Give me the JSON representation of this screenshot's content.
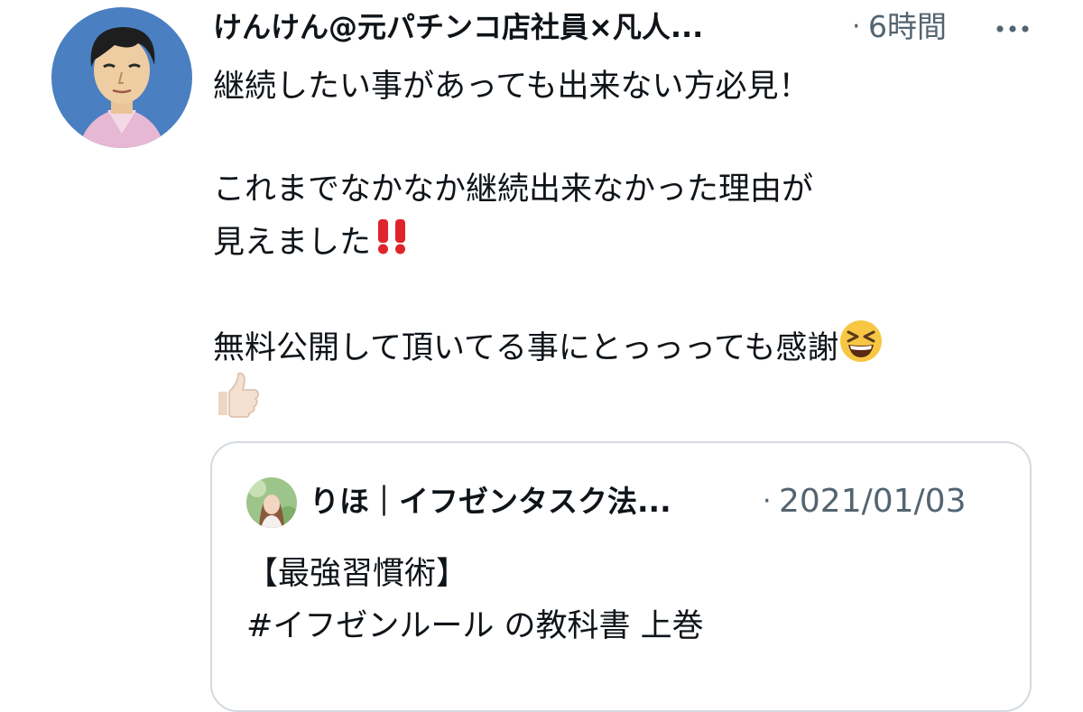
{
  "tweet": {
    "author": {
      "display_name": "けんけん@元パチンコ店社員×凡人...",
      "avatar_icon": "cartoon-man-avatar"
    },
    "separator": "·",
    "time": "6時間",
    "more_icon": "more-horizontal-icon",
    "body": {
      "line1": "継続したい事があっても出来ない方必見！",
      "line2": "これまでなかなか継続出来なかった理由が",
      "line3": "見えました",
      "line3_emoji": "double-exclamation-emoji",
      "line4": "無料公開して頂いてる事にとっっっても感謝",
      "line4_emoji": "grinning-squinting-face-emoji",
      "line5_emoji": "thumbs-up-emoji"
    },
    "quote": {
      "author": {
        "display_name": "りほ｜イフゼンタスク法...",
        "avatar_icon": "woman-photo-avatar"
      },
      "separator": "·",
      "date": "2021/01/03",
      "text_line1": "【最強習慣術】",
      "text_line2": "#イフゼンルール の教科書 上巻"
    }
  },
  "colors": {
    "text_primary": "#0f1419",
    "text_secondary": "#536471",
    "card_border": "#d4dadf",
    "avatar_bg": "#4a7fc1",
    "emoji_red": "#e0242c",
    "emoji_yellow": "#f7c744"
  }
}
